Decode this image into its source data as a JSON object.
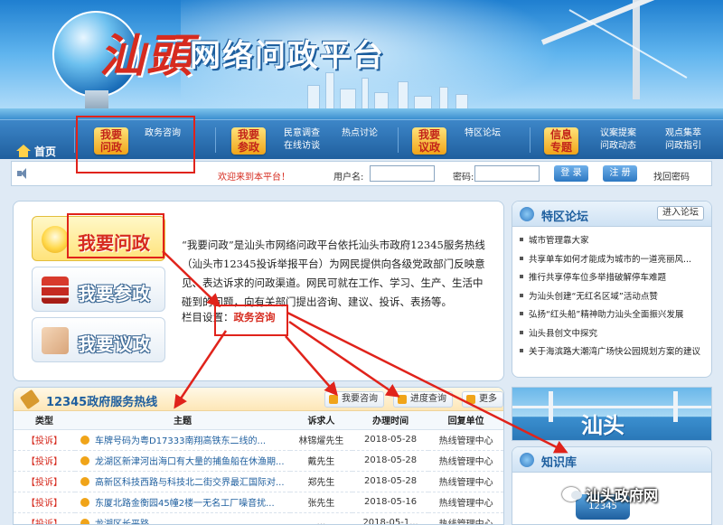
{
  "banner": {
    "calligraphy": "汕頭",
    "title": "网络问政平台"
  },
  "nav": {
    "home": "首页",
    "groups": [
      {
        "badge_line1": "我要",
        "badge_line2": "问政",
        "links": [
          "政务咨询"
        ]
      },
      {
        "badge_line1": "我要",
        "badge_line2": "参政",
        "links": [
          "民意调查",
          "在线访谈",
          "热点讨论"
        ]
      },
      {
        "badge_line1": "我要",
        "badge_line2": "议政",
        "links": [
          "特区论坛"
        ]
      },
      {
        "badge_line1": "信息",
        "badge_line2": "专题",
        "links": [
          "议案提案",
          "问政动态"
        ]
      }
    ],
    "extra_links": [
      "观点集萃",
      "问政指引"
    ]
  },
  "login": {
    "welcome": "欢迎来到本平台！",
    "username_label": "用户名:",
    "username_value": "",
    "password_label": "密码:",
    "password_value": "",
    "login_button": "登 录",
    "register_button": "注 册",
    "forgot": "找回密码"
  },
  "intro": {
    "menu": [
      "我要问政",
      "我要参政",
      "我要议政"
    ],
    "description": "“我要问政”是汕头市网络问政平台依托汕头市政府12345服务热线（汕头市12345投诉举报平台）为网民提供向各级党政部门反映意见、表达诉求的问政渠道。网民可就在工作、学习、生产、生活中碰到的问题，向有关部门提出咨询、建议、投诉、表扬等。",
    "columns_label": "栏目设置：",
    "columns_value": "政务咨询"
  },
  "hotline": {
    "title": "12345政府服务热线",
    "ask_button": "我要咨询",
    "progress_button": "进度查询",
    "more_button": "更多",
    "headers": [
      "类型",
      "主题",
      "诉求人",
      "办理时间",
      "回复单位"
    ],
    "rows": [
      {
        "type": "【投诉】",
        "title": "车牌号码为粤D17333南翔高铁东二线的...",
        "person": "林锦燿先生",
        "date": "2018-05-28",
        "unit": "热线管理中心"
      },
      {
        "type": "【投诉】",
        "title": "龙湖区新津河出海口有大量的捕鱼船在休渔期...",
        "person": "戴先生",
        "date": "2018-05-28",
        "unit": "热线管理中心"
      },
      {
        "type": "【投诉】",
        "title": "高新区科技西路与科技北二街交界最汇国际对...",
        "person": "郑先生",
        "date": "2018-05-28",
        "unit": "热线管理中心"
      },
      {
        "type": "【投诉】",
        "title": "东厦北路金衡园45幢2楼一无名工厂噪音扰...",
        "person": "张先生",
        "date": "2018-05-16",
        "unit": "热线管理中心"
      },
      {
        "type": "【投诉】",
        "title": "龙湖区长平路...",
        "person": "...",
        "date": "2018-05-1...",
        "unit": "热线管理中心"
      }
    ]
  },
  "forum": {
    "title": "特区论坛",
    "enter": "进入论坛",
    "items": [
      "城市管理靠大家",
      "共享单车如何才能成为城市的一道亮丽风...",
      "推行共享停车位多举措破解停车难题",
      "为汕头创建“无红名区域”活动点赞",
      "弘扬“红头船”精神助力汕头全面振兴发展",
      "汕头县创文中探究",
      "关于海滨路大潮湾广场快公园规划方案的建议"
    ]
  },
  "shantou_label": "汕头",
  "kb": {
    "title": "知识库",
    "phone_label": "12345"
  },
  "watermark": "汕头政府网",
  "colors": {
    "accent_red": "#d62b1f",
    "nav_blue": "#1f5f9e",
    "link_blue": "#1d5e9e",
    "badge_gold": "#f0a419"
  }
}
